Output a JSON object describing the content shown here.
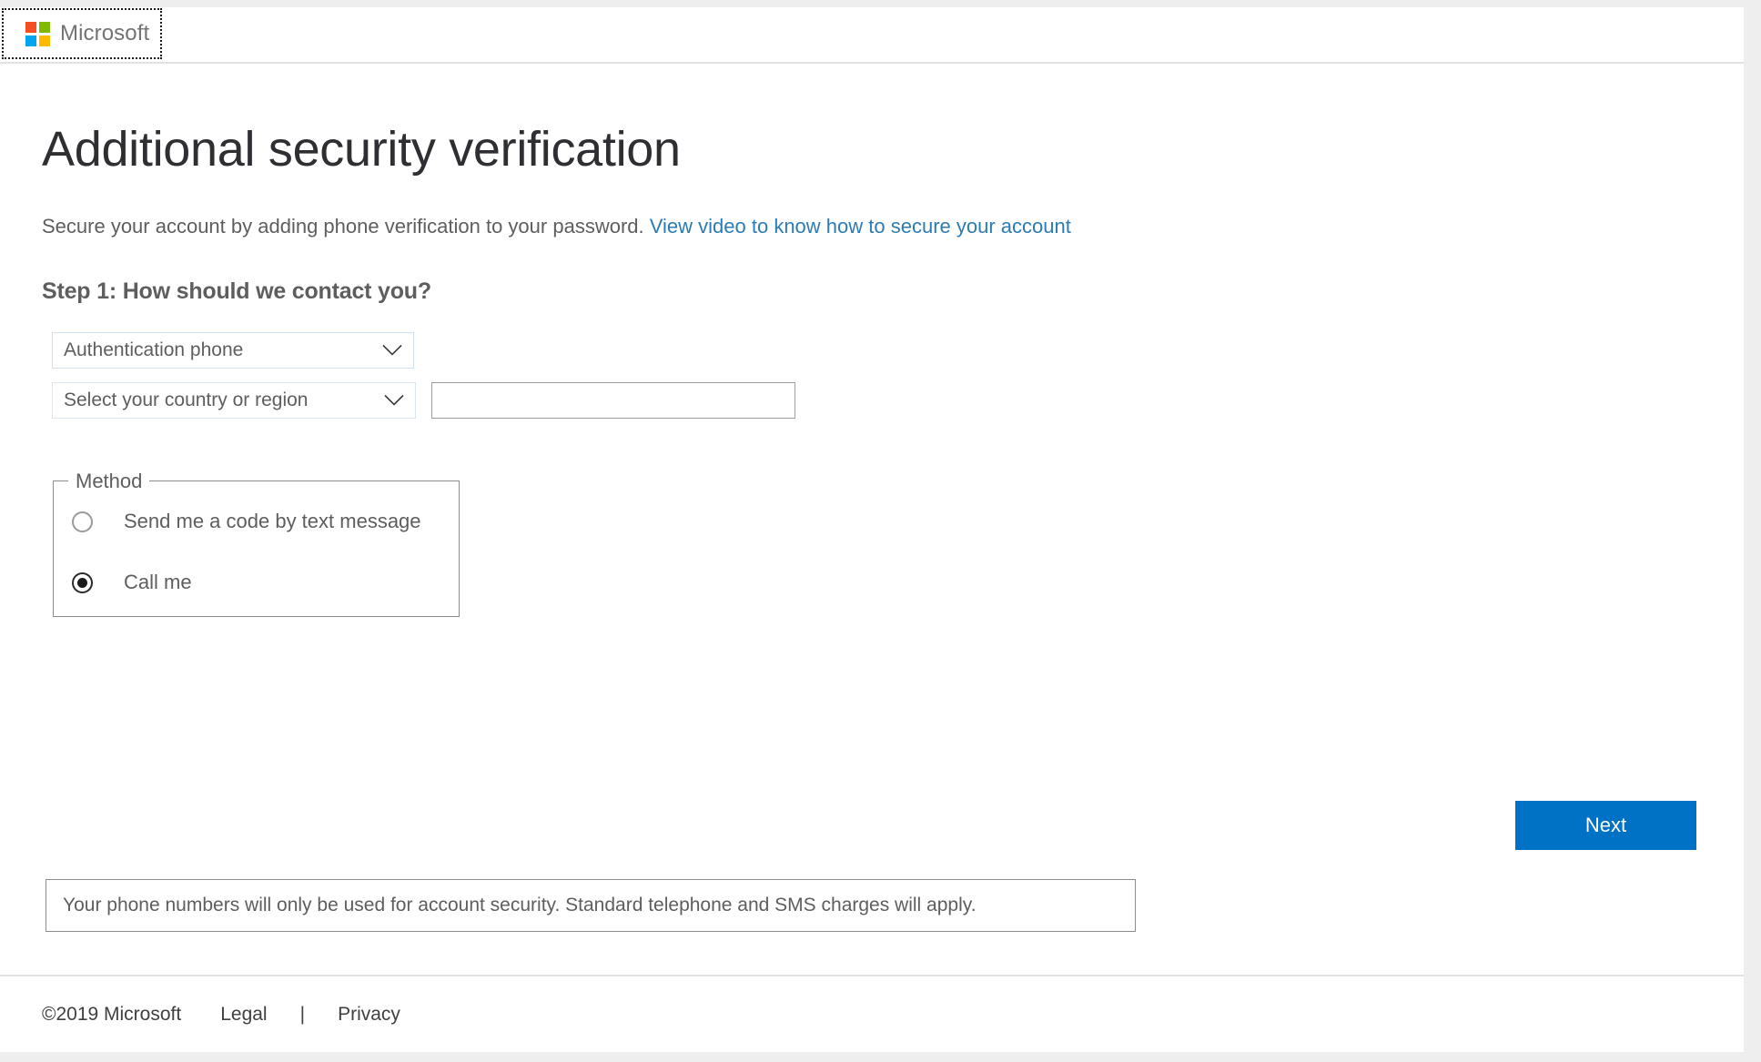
{
  "header": {
    "brand": "Microsoft",
    "logo_colors": {
      "top_left": "#f25022",
      "top_right": "#7fba00",
      "bottom_left": "#00a4ef",
      "bottom_right": "#ffb900"
    }
  },
  "main": {
    "title": "Additional security verification",
    "subtitle_text": "Secure your account by adding phone verification to your password.",
    "subtitle_link": "View video to know how to secure your account",
    "link_color": "#2b7cb5",
    "step_title": "Step 1: How should we contact you?",
    "contact_method_select": {
      "value": "Authentication phone",
      "icon": "chevron-down-icon"
    },
    "country_select": {
      "value": "Select your country or region",
      "icon": "chevron-down-icon"
    },
    "phone_input": {
      "value": "",
      "placeholder": ""
    },
    "method_fieldset": {
      "legend": "Method",
      "options": [
        {
          "label": "Send me a code by text message",
          "selected": false
        },
        {
          "label": "Call me",
          "selected": true
        }
      ]
    },
    "next_button": {
      "label": "Next",
      "color": "#0072c6"
    },
    "disclaimer": "Your phone numbers will only be used for account security. Standard telephone and SMS charges will apply."
  },
  "footer": {
    "copyright": "©2019 Microsoft",
    "legal": "Legal",
    "separator": "|",
    "privacy": "Privacy"
  }
}
